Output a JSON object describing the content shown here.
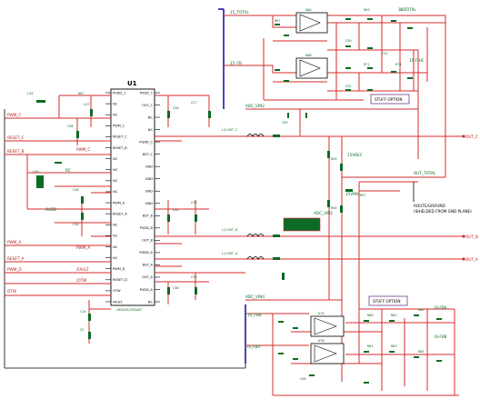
{
  "chip": {
    "ref": "U1",
    "part_label": "LM3429/LM3487",
    "pins_left": [
      "PVDD_1",
      "NC",
      "NC",
      "PWM_C",
      "RESET_C",
      "RESET_B",
      "NC",
      "NC",
      "NC",
      "NC",
      "PWM_A",
      "RESET_A",
      "NC",
      "NC",
      "NC",
      "NC",
      "PWM_D",
      "RESET_D",
      "OTW",
      "FAULT"
    ],
    "pins_right": [
      "PVDD_1",
      "OUT_C",
      "NC",
      "NC",
      "PGND_C",
      "BST_C",
      "GND",
      "GND",
      "GND",
      "GND",
      "BST_B",
      "PVDD_B",
      "OUT_B",
      "PGND_A",
      "BST_A",
      "OUT_A",
      "PVDD_A",
      "NC"
    ]
  },
  "nets_left": [
    "PWM_C",
    "RESET_C",
    "RESET_B",
    "RC",
    "AVDD",
    "PWM_A",
    "RESET_A",
    "PWM_D",
    "RESET_D",
    "/FAULT",
    "/OTW",
    "OTW"
  ],
  "nets_right": [
    "OUT_C",
    "OUT_B",
    "OUT_A"
  ],
  "nets_top": [
    "15_TOTAL",
    "15_FB",
    "ADC_VIN2"
  ],
  "nets_mid": [
    "15VREC",
    "15VMA",
    "OUT_TOTAL"
  ],
  "nets_bottom": [
    "ADC_VIN4",
    "15_FBB",
    "IS_FBA"
  ],
  "stuff_option_top": "STUFF OPTION",
  "stuff_option_bottom": "STUFF OPTION",
  "route_note": [
    "ROUTE/GROUND",
    "(SHIELDED FROM GND PLANE)"
  ]
}
